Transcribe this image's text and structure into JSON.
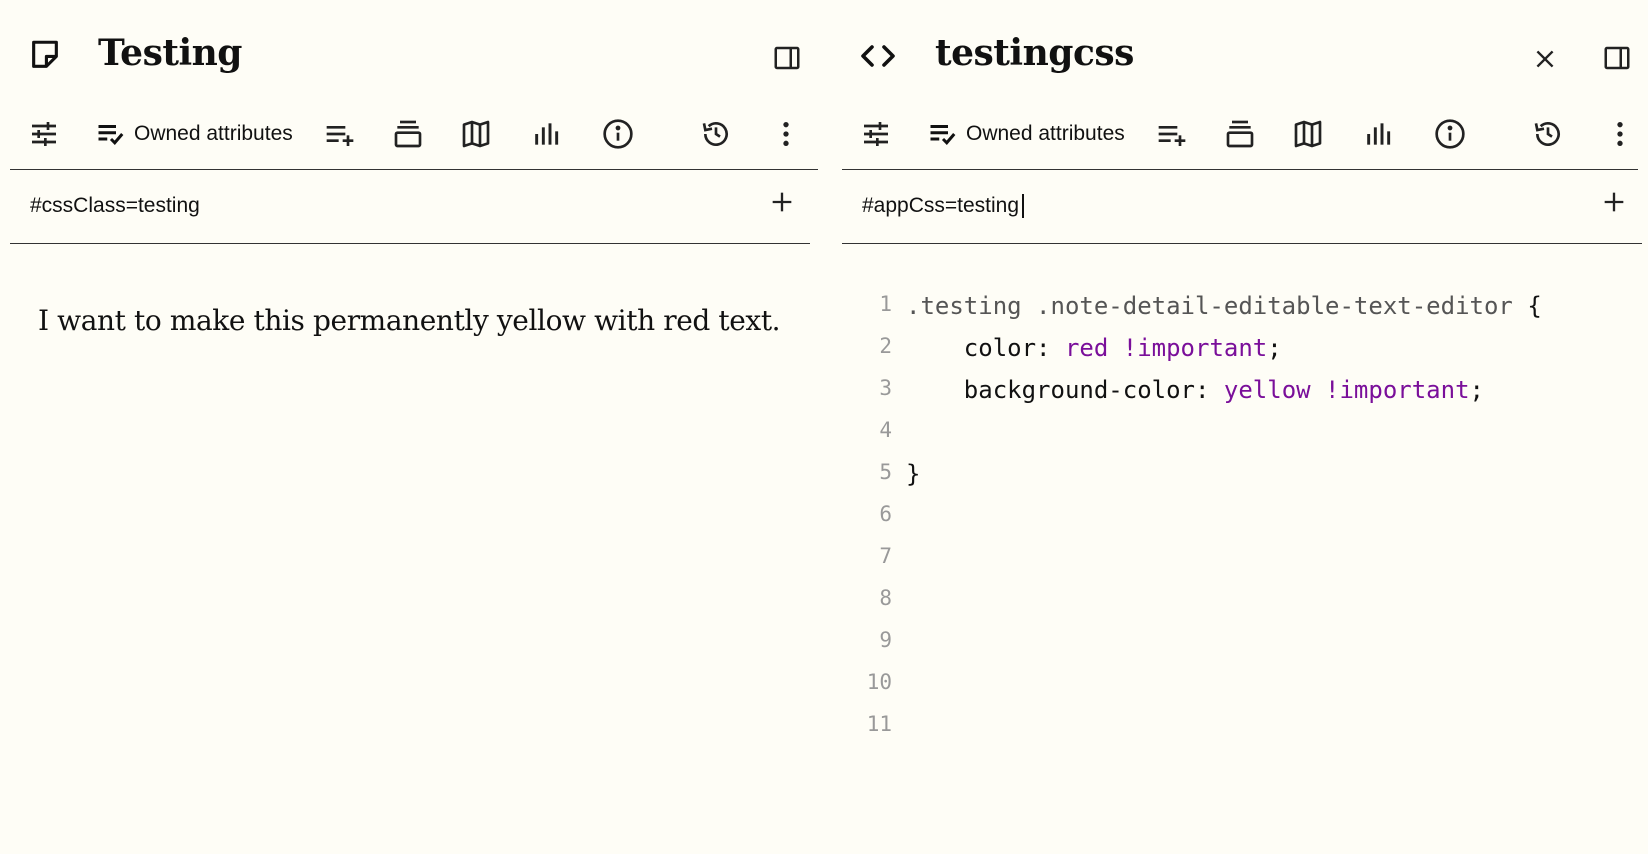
{
  "left_pane": {
    "title": "Testing",
    "ribbon": {
      "owned_label": "Owned attributes"
    },
    "attribute_text": "#cssClass=testing",
    "note_text": "I want to make this permanently yellow with red text."
  },
  "right_pane": {
    "title": "testingcss",
    "ribbon": {
      "owned_label": "Owned attributes"
    },
    "attribute_text": "#appCss=testing",
    "code_lines": [
      {
        "num": "1",
        "parts": [
          {
            "t": ".testing .note-detail-editable-text-editor ",
            "c": "sel"
          },
          {
            "t": "{",
            "c": "punc"
          }
        ]
      },
      {
        "num": "2",
        "parts": [
          {
            "t": "    color",
            "c": "prop"
          },
          {
            "t": ": ",
            "c": "punc"
          },
          {
            "t": "red !important",
            "c": "val"
          },
          {
            "t": ";",
            "c": "punc"
          }
        ]
      },
      {
        "num": "3",
        "parts": [
          {
            "t": "    background-color",
            "c": "prop"
          },
          {
            "t": ": ",
            "c": "punc"
          },
          {
            "t": "yellow !important",
            "c": "val"
          },
          {
            "t": ";",
            "c": "punc"
          }
        ]
      },
      {
        "num": "4",
        "parts": []
      },
      {
        "num": "5",
        "parts": [
          {
            "t": "}",
            "c": "punc"
          }
        ]
      },
      {
        "num": "6",
        "parts": []
      },
      {
        "num": "7",
        "parts": []
      },
      {
        "num": "8",
        "parts": []
      },
      {
        "num": "9",
        "parts": []
      },
      {
        "num": "10",
        "parts": []
      },
      {
        "num": "11",
        "parts": []
      }
    ]
  },
  "icons": {
    "note_type": "note-icon",
    "code_type": "code-icon",
    "sidebar_toggle": "sidebar-toggle-icon",
    "close": "close-icon",
    "ribbon": [
      "settings-sliders-icon",
      "owned-attributes-icon",
      "add-attribute-icon",
      "note-map-layers-icon",
      "map-icon",
      "bar-chart-icon",
      "info-icon",
      "history-icon",
      "more-vertical-icon"
    ],
    "add": "plus-icon"
  },
  "colors": {
    "background": "#fefdf6",
    "code_value": "#7a0f9a",
    "code_selector": "#555555",
    "line_number": "#999999"
  }
}
